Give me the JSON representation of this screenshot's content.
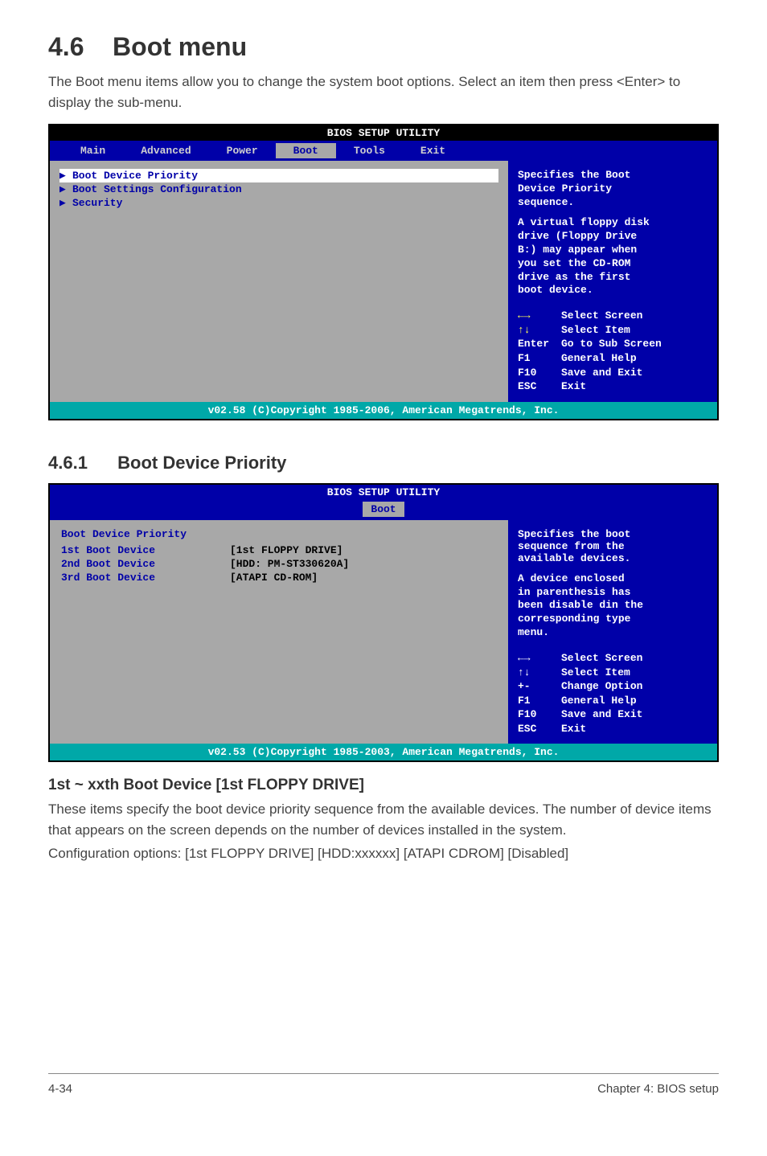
{
  "s46": "4.6",
  "s46title": "Boot menu",
  "intro": "The Boot menu items allow you to change the system boot options. Select an item then press <Enter> to display the sub-menu.",
  "bios1": {
    "header": "BIOS SETUP UTILITY",
    "menus": [
      "Main",
      "Advanced",
      "Power",
      "Boot",
      "Tools",
      "Exit"
    ],
    "items": [
      "Boot Device Priority",
      "Boot Settings Configuration",
      "Security"
    ],
    "help": {
      "l1": "Specifies the Boot",
      "l2": "Device Priority",
      "l3": "sequence.",
      "b1": "A virtual floppy disk",
      "b2": "drive (Floppy Drive",
      "b3": "B:) may appear when",
      "b4": "you set the CD-ROM",
      "b5": "drive as the first",
      "b6": "boot device."
    },
    "keys": [
      {
        "k": "←→",
        "v": "Select Screen"
      },
      {
        "k": "↑↓",
        "v": "Select Item"
      },
      {
        "k": "Enter",
        "v": "Go to Sub Screen"
      },
      {
        "k": "F1",
        "v": "General Help"
      },
      {
        "k": "F10",
        "v": "Save and Exit"
      },
      {
        "k": "ESC",
        "v": "Exit"
      }
    ],
    "footer": "v02.58 (C)Copyright 1985-2006, American Megatrends, Inc."
  },
  "s461num": "4.6.1",
  "s461title": "Boot Device Priority",
  "bios2": {
    "header": "BIOS SETUP UTILITY",
    "tab": "Boot",
    "title": "Boot Device Priority",
    "rows": [
      {
        "label": "1st Boot Device",
        "val": "[1st FLOPPY DRIVE]"
      },
      {
        "label": "2nd Boot Device",
        "val": "[HDD: PM-ST330620A]"
      },
      {
        "label": "3rd Boot Device",
        "val": "[ATAPI CD-ROM]"
      }
    ],
    "help": {
      "l1": "Specifies the boot",
      "l2": "sequence from the",
      "l3": "available devices.",
      "b1": "A device enclosed",
      "b2": "in parenthesis has",
      "b3": "been disable din the",
      "b4": "corresponding type",
      "b5": "menu."
    },
    "keys": [
      {
        "k": "←→",
        "v": "Select Screen"
      },
      {
        "k": "↑↓",
        "v": "Select Item"
      },
      {
        "k": "+-",
        "v": "Change Option"
      },
      {
        "k": "F1",
        "v": "General Help"
      },
      {
        "k": "F10",
        "v": "Save and Exit"
      },
      {
        "k": "ESC",
        "v": "Exit"
      }
    ],
    "footer": "v02.53 (C)Copyright 1985-2003, American Megatrends, Inc."
  },
  "sub": {
    "h3": "1st ~ xxth Boot Device [1st FLOPPY DRIVE]",
    "p1": "These items specify the boot device priority sequence from the available devices. The number of device items that appears on the screen depends on the number of devices installed in the system.",
    "p2": "Configuration options: [1st FLOPPY DRIVE] [HDD:xxxxxx] [ATAPI CDROM] [Disabled]"
  },
  "footer": {
    "left": "4-34",
    "right": "Chapter 4: BIOS setup"
  }
}
